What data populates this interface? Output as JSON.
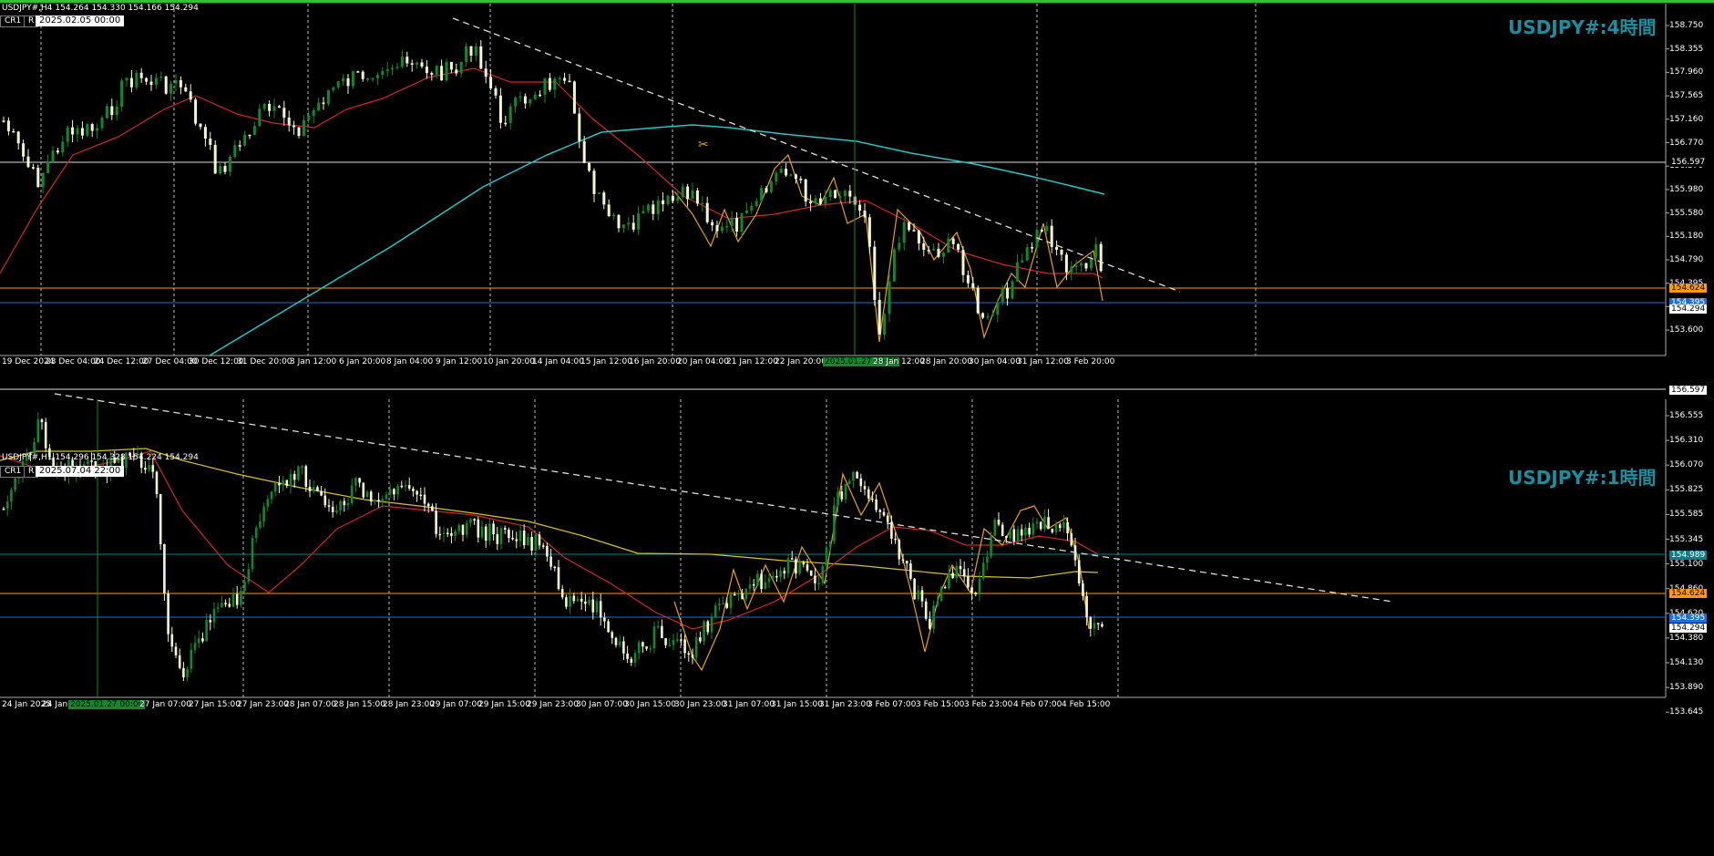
{
  "charts": [
    {
      "header": "USDJPY#,H4  154.264 154.330 154.166 154.294",
      "cr_label": "CR1",
      "r_label": "R",
      "date_box": "2025.02.05 00:00",
      "big_title": "USDJPY#:4時間",
      "price_axis": [
        "158.750",
        "158.355",
        "157.960",
        "157.565",
        "157.160",
        "156.770",
        "156.370",
        "155.980",
        "155.580",
        "155.180",
        "154.790",
        "154.395",
        "154.000",
        "153.600"
      ],
      "time_axis": [
        "19 Dec 2024",
        "23 Dec 04:00",
        "24 Dec 12:00",
        "27 Dec 04:00",
        "30 Dec 12:00",
        "31 Dec 20:00",
        "3 Jan 12:00",
        "6 Jan 20:00",
        "8 Jan 04:00",
        "9 Jan 12:00",
        "10 Jan 20:00",
        "14 Jan 04:00",
        "15 Jan 12:00",
        "16 Jan 20:00",
        "20 Jan 04:00",
        "21 Jan 12:00",
        "22 Jan 20:00",
        "2025.01.27 00:00",
        "28 Jan 12:00",
        "28 Jan 20:00",
        "30 Jan 04:00",
        "31 Jan 12:00",
        "3 Feb 20:00"
      ],
      "level_labels": [
        {
          "text": "156.597",
          "color": "#ffffff",
          "bg": "#000000"
        },
        {
          "text": "154.624",
          "color": "#000000",
          "bg": "#ff9a00"
        },
        {
          "text": "154.395",
          "color": "#ffffff",
          "bg": "#1e6fd9"
        },
        {
          "text": "154.294",
          "color": "#000000",
          "bg": "#ffffff"
        }
      ]
    },
    {
      "header": "USDJPY#,H1  154.296 154.328 154.224 154.294",
      "cr_label": "CR1",
      "r_label": "R",
      "date_box": "2025.07.04 22:00",
      "big_title": "USDJPY#:1時間",
      "price_axis": [
        "156.555",
        "156.310",
        "156.070",
        "155.825",
        "155.585",
        "155.345",
        "155.100",
        "154.860",
        "154.620",
        "154.380",
        "154.130",
        "153.890",
        "153.645"
      ],
      "time_axis": [
        "24 Jan 2025",
        "24 Jan",
        "2025.01.27 00:00",
        "27 Jan 07:00",
        "27 Jan 15:00",
        "27 Jan 23:00",
        "28 Jan 07:00",
        "28 Jan 15:00",
        "28 Jan 23:00",
        "29 Jan 07:00",
        "29 Jan 15:00",
        "29 Jan 23:00",
        "30 Jan 07:00",
        "30 Jan 15:00",
        "30 Jan 23:00",
        "31 Jan 07:00",
        "31 Jan 15:00",
        "31 Jan 23:00",
        "3 Feb 07:00",
        "3 Feb 15:00",
        "3 Feb 23:00",
        "4 Feb 07:00",
        "4 Feb 15:00"
      ],
      "level_labels": [
        {
          "text": "156.597",
          "color": "#000000",
          "bg": "#ffffff"
        },
        {
          "text": "154.989",
          "color": "#ffffff",
          "bg": "#0e7d8a"
        },
        {
          "text": "154.624",
          "color": "#000000",
          "bg": "#ff9a00"
        },
        {
          "text": "154.395",
          "color": "#ffffff",
          "bg": "#1e6fd9"
        },
        {
          "text": "154.294",
          "color": "#000000",
          "bg": "#ffffff"
        }
      ]
    }
  ],
  "colors": {
    "bull": "#0e8a2c",
    "bear": "#f4f7d0",
    "ma_red": "#d42424",
    "ma_cyan": "#20c7c7",
    "ma_yellow": "#d6c21c",
    "zigzag": "#e8a10c",
    "trend": "#dddddd"
  }
}
